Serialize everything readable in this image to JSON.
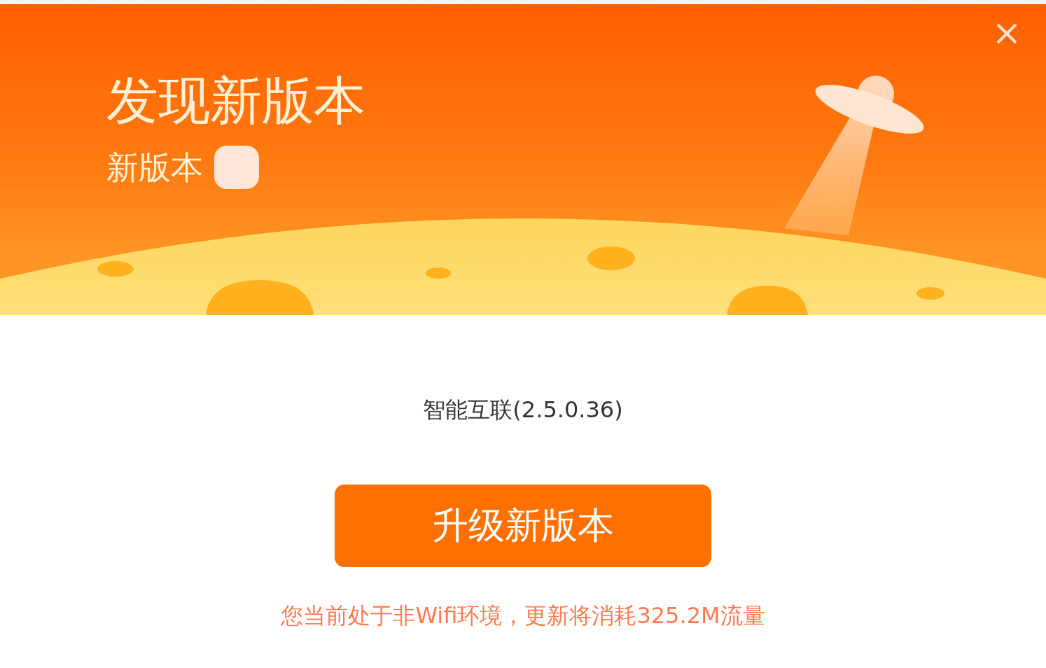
{
  "header": {
    "title": "发现新版本",
    "subtitle": "新版本"
  },
  "app": {
    "name_version": "智能互联(2.5.0.36)"
  },
  "upgrade_button": {
    "label": "升级新版本"
  },
  "notice": "您当前处于非Wifi环境，更新将消耗325.2M流量"
}
